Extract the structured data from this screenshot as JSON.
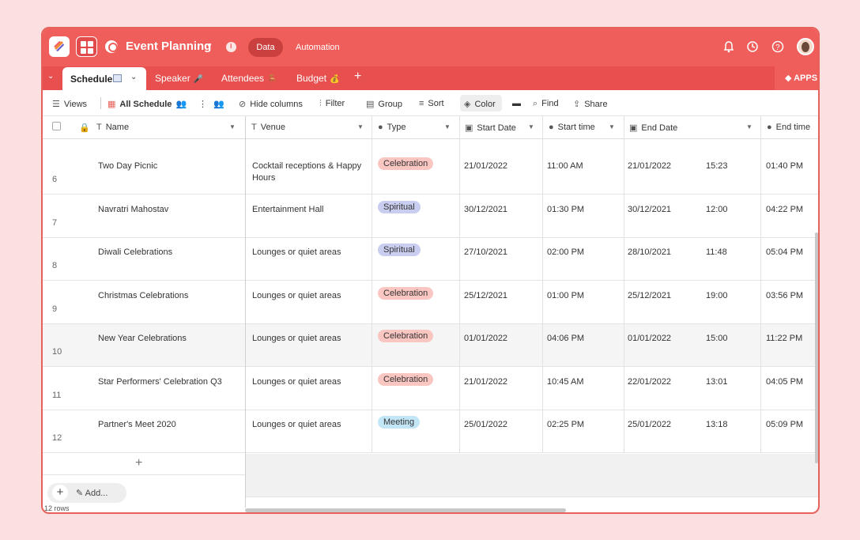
{
  "header": {
    "workspace_title": "Event Planning",
    "data_label": "Data",
    "automation_label": "Automation",
    "brand_color": "#ef5e5a"
  },
  "tabs": {
    "active": "Schedule",
    "items": [
      {
        "label": "Speaker",
        "emoji": "🎤"
      },
      {
        "label": "Attendees",
        "emoji": "🪑"
      },
      {
        "label": "Budget",
        "emoji": "💰"
      }
    ],
    "apps_label": "APPS"
  },
  "toolbar": {
    "views": "Views",
    "view_name": "All Schedule",
    "hide_columns": "Hide columns",
    "filter": "Filter",
    "group": "Group",
    "sort": "Sort",
    "color": "Color",
    "find": "Find",
    "share": "Share"
  },
  "columns": [
    "Name",
    "Venue",
    "Type",
    "Start Date",
    "Start time",
    "End Date",
    "End time"
  ],
  "rows": [
    {
      "num": "6",
      "name": "Two Day Picnic",
      "venue": "Cocktail receptions & Happy Hours",
      "type": "Celebration",
      "start_date": "21/01/2022",
      "start_time": "11:00 AM",
      "end_date": "21/01/2022",
      "end_hhmm": "15:23",
      "end_time": "01:40 PM"
    },
    {
      "num": "7",
      "name": "Navratri Mahostav",
      "venue": "Entertainment Hall",
      "type": "Spiritual",
      "start_date": "30/12/2021",
      "start_time": "01:30 PM",
      "end_date": "30/12/2021",
      "end_hhmm": "12:00",
      "end_time": "04:22 PM"
    },
    {
      "num": "8",
      "name": "Diwali Celebrations",
      "venue": "Lounges or quiet areas",
      "type": "Spiritual",
      "start_date": "27/10/2021",
      "start_time": "02:00 PM",
      "end_date": "28/10/2021",
      "end_hhmm": "11:48",
      "end_time": "05:04 PM"
    },
    {
      "num": "9",
      "name": "Christmas Celebrations",
      "venue": "Lounges or quiet areas",
      "type": "Celebration",
      "start_date": "25/12/2021",
      "start_time": "01:00 PM",
      "end_date": "25/12/2021",
      "end_hhmm": "19:00",
      "end_time": "03:56 PM"
    },
    {
      "num": "10",
      "name": "New Year Celebrations",
      "venue": "Lounges or quiet areas",
      "type": "Celebration",
      "start_date": "01/01/2022",
      "start_time": "04:06 PM",
      "end_date": "01/01/2022",
      "end_hhmm": "15:00",
      "end_time": "11:22 PM"
    },
    {
      "num": "11",
      "name": "Star Performers' Celebration Q3",
      "venue": "Lounges or quiet areas",
      "type": "Celebration",
      "start_date": "21/01/2022",
      "start_time": "10:45 AM",
      "end_date": "22/01/2022",
      "end_hhmm": "13:01",
      "end_time": "04:05 PM"
    },
    {
      "num": "12",
      "name": "Partner's Meet 2020",
      "venue": "Lounges or quiet areas",
      "type": "Meeting",
      "start_date": "25/01/2022",
      "start_time": "02:25 PM",
      "end_date": "25/01/2022",
      "end_hhmm": "13:18",
      "end_time": "05:09 PM"
    }
  ],
  "footer": {
    "add_label": "Add...",
    "row_count": "12 rows"
  },
  "type_colors": {
    "Celebration": "#f9c6c1",
    "Spiritual": "#c9cdef",
    "Meeting": "#c3e6f7"
  }
}
